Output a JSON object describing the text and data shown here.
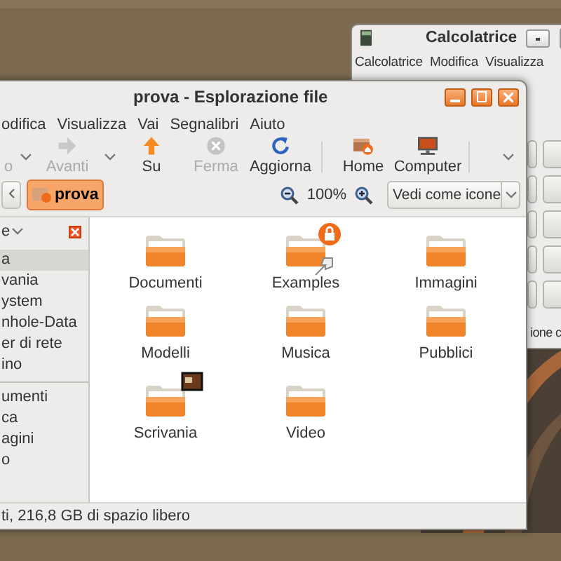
{
  "calculator": {
    "title": "Calcolatrice",
    "menu": [
      "Calcolatrice",
      "Modifica",
      "Visualizza"
    ],
    "status": "ione c"
  },
  "window": {
    "title": "prova - Esplorazione file"
  },
  "menu": [
    "odifica",
    "Visualizza",
    "Vai",
    "Segnalibri",
    "Aiuto"
  ],
  "toolbar": {
    "groups": [
      [
        {
          "label": "o",
          "disabled": true,
          "dropdown": true
        },
        {
          "label": "Avanti",
          "disabled": true,
          "dropdown": true
        },
        {
          "label": "Su",
          "disabled": false
        },
        {
          "label": "Ferma",
          "disabled": true
        },
        {
          "label": "Aggiorna",
          "disabled": false
        }
      ],
      [
        {
          "label": "Home",
          "disabled": false
        },
        {
          "label": "Computer",
          "disabled": false
        }
      ]
    ]
  },
  "location": {
    "path": [
      {
        "label": "prova",
        "selected": true
      }
    ],
    "zoom": "100%",
    "view": "Vedi come icone"
  },
  "sidebar": {
    "title": "e",
    "sections": [
      [
        {
          "label": "a",
          "selected": true
        },
        {
          "label": "vania",
          "selected": false
        },
        {
          "label": "ystem",
          "selected": false
        },
        {
          "label": "nhole-Data",
          "selected": false
        },
        {
          "label": "er di rete",
          "selected": false
        },
        {
          "label": "ino",
          "selected": false
        }
      ],
      [
        {
          "label": "umenti",
          "selected": false
        },
        {
          "label": "ca",
          "selected": false
        },
        {
          "label": "agini",
          "selected": false
        },
        {
          "label": "o",
          "selected": false
        }
      ]
    ]
  },
  "files": [
    {
      "name": "Documenti"
    },
    {
      "name": "Examples"
    },
    {
      "name": "Immagini"
    },
    {
      "name": "Modelli"
    },
    {
      "name": "Musica"
    },
    {
      "name": "Pubblici"
    },
    {
      "name": "Scrivania"
    },
    {
      "name": "Video"
    }
  ],
  "status_bar": "ti, 216,8 GB di spazio libero"
}
